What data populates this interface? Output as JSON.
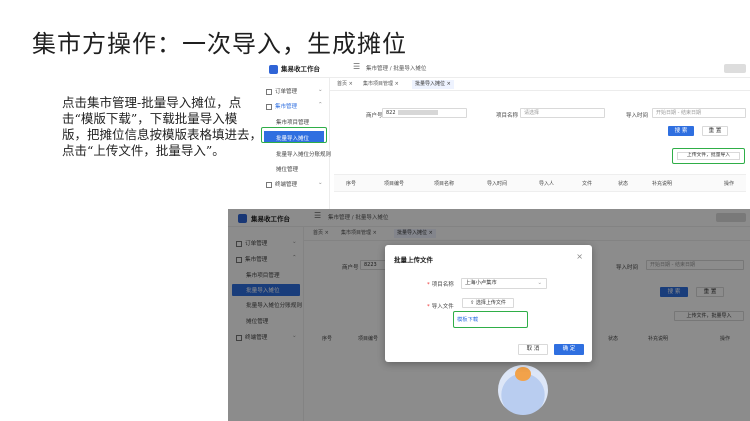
{
  "slide": {
    "title": "集市方操作：一次导入，生成摊位",
    "description": "点击集市管理-批量导入摊位，点击“模版下载”，下载批量导入模版，把摊位信息按模版表格填进去，点击“上传文件，批量导入”。"
  },
  "app": {
    "name": "集易收工作台",
    "menu_icon": "hamburger-icon",
    "breadcrumb": "集市管理 / 批量导入摊位"
  },
  "sidebar": {
    "orders": "订单管理",
    "market": "集市管理",
    "market_items": [
      "集市项目管理",
      "批量导入摊位",
      "批量导入摊位分账规则",
      "摊位管理"
    ],
    "terminal": "终端管理"
  },
  "tabs": {
    "home": "首页",
    "project_mgmt": "集市项目管理",
    "batch_import": "批量导入摊位",
    "close_glyph": "×"
  },
  "form": {
    "merchant_label": "商户号",
    "merchant_value": "822",
    "merchant_value_2": "8223",
    "project_label": "项目名称",
    "project_placeholder": "请选择",
    "import_time_label": "导入时间",
    "start_placeholder": "开始日期",
    "end_placeholder": "结束日期",
    "time_sep": "-",
    "search": "搜 索",
    "reset": "重 置",
    "upload": "上传文件，批量导入"
  },
  "table": {
    "headers": [
      "序号",
      "项目编号",
      "项目名称",
      "导入时间",
      "导入人",
      "文件",
      "状态",
      "补充说明",
      "操作"
    ]
  },
  "modal": {
    "title": "批量上传文件",
    "close": "×",
    "project_label": "项目名称",
    "project_value": "上海小卢集市",
    "file_label": "导入文件",
    "select_file": "选择上传文件",
    "template_download": "模板下载",
    "cancel": "取 消",
    "ok": "确 定",
    "required_mark": "*"
  },
  "colors": {
    "primary": "#2f6fe0",
    "highlight": "#2fae48",
    "logo": "#2f64d6"
  }
}
